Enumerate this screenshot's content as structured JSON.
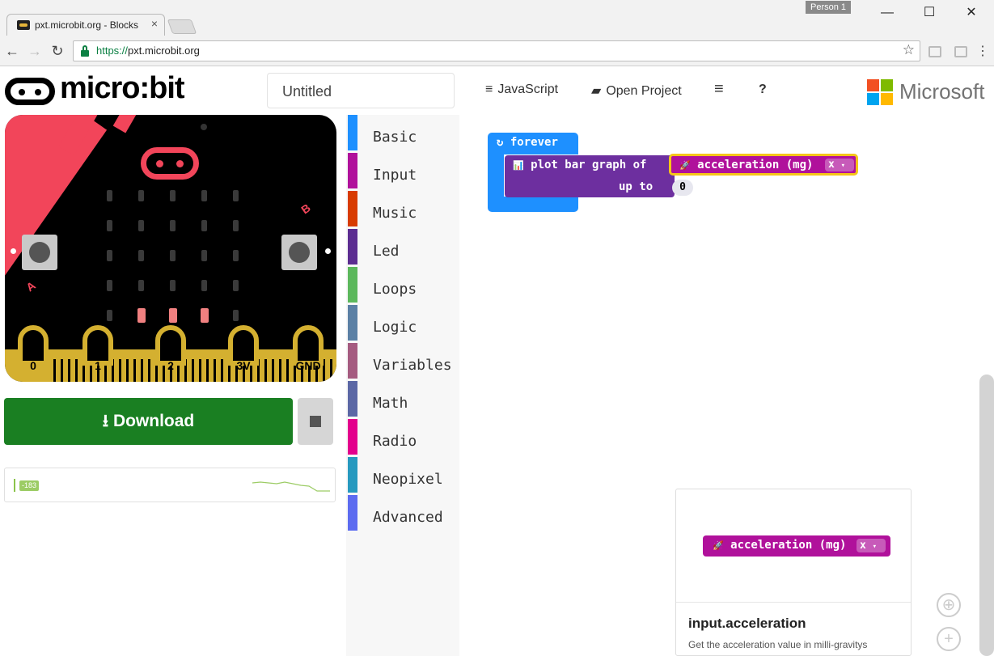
{
  "browser": {
    "tab_title": "pxt.microbit.org - Blocks",
    "tab_close": "×",
    "profile_label": "Person 1",
    "window_controls": {
      "minimize": "—",
      "maximize": "☐",
      "close": "✕"
    },
    "back": "←",
    "forward": "→",
    "reload": "↻",
    "url_scheme": "https://",
    "url_host": "pxt.microbit.org",
    "star": "☆",
    "menu": "⋮"
  },
  "header": {
    "logo_text": "micro:bit",
    "project_name": "Untitled",
    "javascript_icon": "≡",
    "javascript_label": "JavaScript",
    "open_project_icon": "▰",
    "open_project_label": "Open Project",
    "menu_icon": "≡",
    "help_label": "?",
    "brand_label": "Microsoft",
    "brand_colors": [
      "#f25022",
      "#7fba00",
      "#00a4ef",
      "#ffb900"
    ]
  },
  "simulator": {
    "button_a": "A",
    "button_b": "B",
    "pins": [
      "0",
      "1",
      "2",
      "3V",
      "GND"
    ],
    "lit_leds": [
      [
        4,
        1
      ],
      [
        4,
        2
      ],
      [
        4,
        3
      ]
    ],
    "accent_color": "#f2455a",
    "download_icon": "⭳",
    "download_label": "Download",
    "serial_value": "-183"
  },
  "toolbox": {
    "categories": [
      {
        "label": "Basic",
        "color": "#1e90ff"
      },
      {
        "label": "Input",
        "color": "#b0119b"
      },
      {
        "label": "Music",
        "color": "#d83b01"
      },
      {
        "label": "Led",
        "color": "#5c2d91"
      },
      {
        "label": "Loops",
        "color": "#5cb85c"
      },
      {
        "label": "Logic",
        "color": "#5b80a5"
      },
      {
        "label": "Variables",
        "color": "#a55b80"
      },
      {
        "label": "Math",
        "color": "#5b67a5"
      },
      {
        "label": "Radio",
        "color": "#e3008c"
      },
      {
        "label": "Neopixel",
        "color": "#2699bf"
      },
      {
        "label": "Advanced",
        "color": "#5c6bf0"
      }
    ]
  },
  "workspace": {
    "forever_icon": "↻",
    "forever_label": "forever",
    "plot_icon": "📊",
    "plot_label": "plot bar graph of",
    "up_to_label": "up to",
    "up_to_value": "0",
    "accel_icon": "🚀",
    "accel_label": "acceleration (mg)",
    "accel_axis": "x",
    "dropdown_arrow": "▾"
  },
  "help": {
    "preview_label": "acceleration (mg)",
    "preview_axis": "x",
    "title": "input.acceleration",
    "description": "Get the acceleration value in milli-gravitys"
  },
  "controls": {
    "recenter": "⊕",
    "zoom_in": "+"
  }
}
